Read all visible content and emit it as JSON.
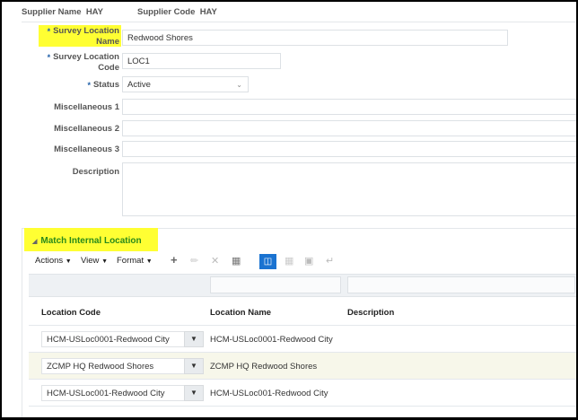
{
  "header": {
    "supplier_name_label": "Supplier Name",
    "supplier_name": "HAY",
    "supplier_code_label": "Supplier Code",
    "supplier_code": "HAY"
  },
  "form": {
    "required_marker": "*",
    "survey_location_name_label_1": "Survey Location",
    "survey_location_name_label_2": "Name",
    "survey_location_name": "Redwood Shores",
    "survey_location_code_label_1": "Survey Location",
    "survey_location_code_label_2": "Code",
    "survey_location_code": "LOC1",
    "status_label": "Status",
    "status": "Active",
    "misc1_label": "Miscellaneous 1",
    "misc2_label": "Miscellaneous 2",
    "misc3_label": "Miscellaneous 3",
    "description_label": "Description"
  },
  "section": {
    "title": "Match Internal Location",
    "toolbar": {
      "actions": "Actions",
      "view": "View",
      "format": "Format"
    },
    "columns": [
      "Location Code",
      "Location Name",
      "Description"
    ],
    "rows": [
      {
        "code": "HCM-USLoc0001-Redwood City",
        "name": "HCM-USLoc0001-Redwood City",
        "description": ""
      },
      {
        "code": "ZCMP HQ Redwood Shores",
        "name": "ZCMP HQ Redwood Shores",
        "description": ""
      },
      {
        "code": "HCM-USLoc001-Redwood City",
        "name": "HCM-USLoc001-Redwood City",
        "description": ""
      }
    ]
  },
  "colors": {
    "highlight": "#ffff33",
    "section_title": "#2a8a1a",
    "selected_row": "#f7f7ea",
    "filter_button": "#1a73d1"
  }
}
